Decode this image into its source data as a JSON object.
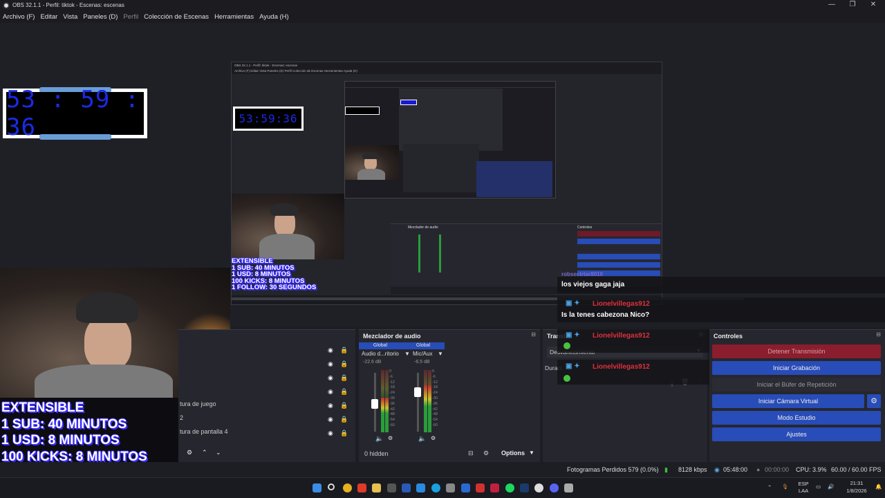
{
  "window": {
    "title": "OBS 32.1.1 - Perfil: tiktok - Escenas: escenas",
    "minimize": "—",
    "maximize": "❐",
    "close": "✕"
  },
  "menu": {
    "items": [
      "Archivo (F)",
      "Editar",
      "Vista",
      "Paneles (D)",
      "Perfil",
      "Colección de Escenas",
      "Herramientas",
      "Ayuda (H)"
    ]
  },
  "preview": {
    "timer": "53 : 59 : 36",
    "nested_timer": "53:59:36",
    "nested_title": "OBS 32.1.1 - Perfil: tiktok - Escenas: escenas",
    "nested_menu": "Archivo (F)   Editar   Vista   Paneles (D)   Perfil   Colección de Escenas   Herramientas   Ayuda (H)",
    "overlay_lines": [
      "EXTENSIBLE",
      "1 SUB: 40 MINUTOS",
      "1 USD: 8 MINUTOS",
      "100 KICKS: 8 MINUTOS",
      "1 FOLLOW: 30 SEGUNDOS"
    ]
  },
  "chat": {
    "messages": [
      {
        "user": "robsectrtar8010",
        "text": "los viejos gaga jaja"
      },
      {
        "user": "Lionelvillegas912",
        "text": "Is la tenes cabezona Nico?"
      },
      {
        "user": "Lionelvillegas912",
        "text": ""
      },
      {
        "user": "Lionelvillegas912",
        "text": ""
      }
    ],
    "user_color": "#e0303c"
  },
  "sources": {
    "rows": [
      "tura de juego",
      "2",
      "tura de pantalla 4"
    ]
  },
  "mixer": {
    "title": "Mezclador de audio",
    "channels": [
      {
        "tag": "Global",
        "name": "Audio d...ritorio",
        "db": "-22.6 dB",
        "level": 0.55
      },
      {
        "tag": "Global",
        "name": "Mic/Aux",
        "db": "-6.5 dB",
        "level": 0.75
      }
    ],
    "scale": [
      "0",
      "-6",
      "-12",
      "-18",
      "-24",
      "-30",
      "-36",
      "-42",
      "-48",
      "-54",
      "-60"
    ],
    "hidden": "0 hidden",
    "options": "Options"
  },
  "transitions": {
    "title": "Transi",
    "fade": "Desvanecimiento",
    "duration": "Duraci"
  },
  "controls": {
    "title": "Controles",
    "stop_stream": "Detener Transmisión",
    "start_recording": "Iniciar Grabación",
    "replay_buffer": "Iniciar el Búfer de Repetición",
    "virtual_cam": "Iniciar Cámara Virtual",
    "studio_mode": "Modo Estudio",
    "settings": "Ajustes"
  },
  "status": {
    "dropped": "Fotogramas Perdidos 579 (0.0%)",
    "bitrate": "8128 kbps",
    "stream_time": "05:48:00",
    "rec_time": "00:00:00",
    "cpu": "CPU: 3.9%",
    "fps": "60.00 / 60.00 FPS"
  },
  "taskbar": {
    "lang": "ESP",
    "layout": "LAA",
    "time": "21:31",
    "date": "1/8/2026"
  }
}
